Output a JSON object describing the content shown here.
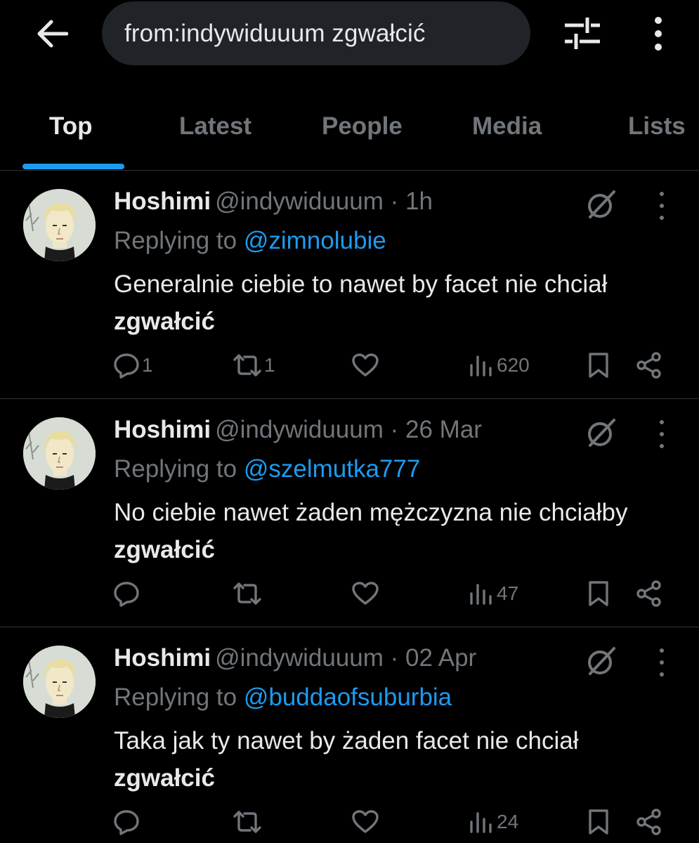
{
  "search": {
    "query": "from:indywiduuum zgwałcić"
  },
  "tabs": [
    {
      "label": "Top"
    },
    {
      "label": "Latest"
    },
    {
      "label": "People"
    },
    {
      "label": "Media"
    },
    {
      "label": "Lists"
    }
  ],
  "tweets": [
    {
      "name": "Hoshimi",
      "handle": "@indywiduuum",
      "sep": "·",
      "time": "1h",
      "replying_prefix": "Replying to",
      "replying_to": "@zimnolubie",
      "text": "Generalnie ciebie to nawet by facet nie chciał",
      "text_bold": "zgwałcić",
      "replies": "1",
      "reposts": "1",
      "likes": "",
      "views": "620"
    },
    {
      "name": "Hoshimi",
      "handle": "@indywiduuum",
      "sep": "·",
      "time": "26 Mar",
      "replying_prefix": "Replying to",
      "replying_to": "@szelmutka777",
      "text": "No ciebie nawet żaden mężczyzna nie chciałby",
      "text_bold": "zgwałcić",
      "replies": "",
      "reposts": "",
      "likes": "",
      "views": "47"
    },
    {
      "name": "Hoshimi",
      "handle": "@indywiduuum",
      "sep": "·",
      "time": "02 Apr",
      "replying_prefix": "Replying to",
      "replying_to": "@buddaofsuburbia",
      "text": "Taka jak ty nawet by żaden facet nie chciał",
      "text_bold": "zgwałcić",
      "replies": "",
      "reposts": "",
      "likes": "",
      "views": "24"
    }
  ],
  "colors": {
    "accent": "#1d9bf0",
    "text_primary": "#e7e9ea",
    "text_secondary": "#71767b",
    "divider": "#2f3336",
    "background": "#000000"
  },
  "icons": {
    "back": "arrow-left-icon",
    "filter": "sliders-icon",
    "more": "more-vertical-icon",
    "grok": "grok-icon",
    "reply": "reply-icon",
    "repost": "repost-icon",
    "like": "heart-icon",
    "views": "views-icon",
    "bookmark": "bookmark-icon",
    "share": "share-icon"
  }
}
